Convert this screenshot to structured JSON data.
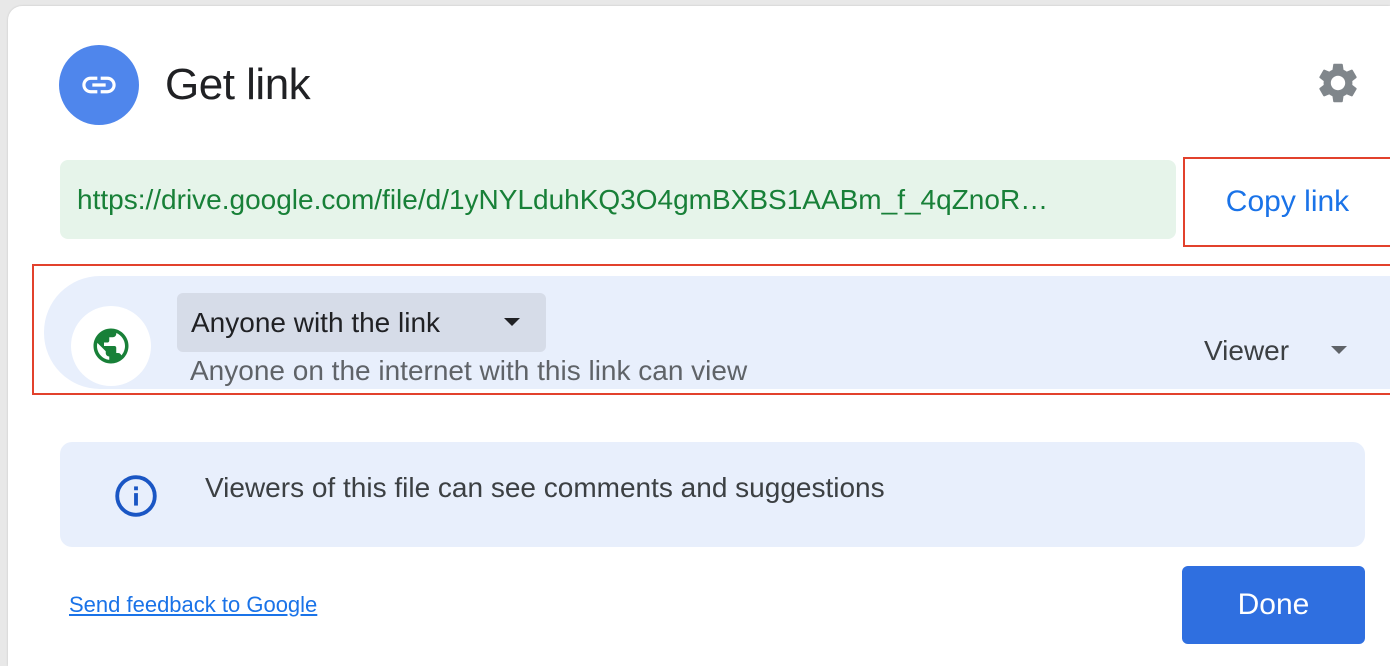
{
  "dialog": {
    "title": "Get link",
    "header_icon": "link-icon",
    "settings_icon": "gear-icon"
  },
  "link": {
    "url": "https://drive.google.com/file/d/1yNYLduhKQ3O4gmBXBS1AABm_f_4qZnoR…",
    "copy_label": "Copy link"
  },
  "access": {
    "icon": "globe-icon",
    "scope_label": "Anyone with the link",
    "scope_description": "Anyone on the internet with this link can view",
    "role_label": "Viewer"
  },
  "info": {
    "icon": "info-icon",
    "text": "Viewers of this file can see comments and suggestions"
  },
  "footer": {
    "feedback_label": "Send feedback to Google",
    "done_label": "Done"
  },
  "colors": {
    "accent": "#1a73e8",
    "link_bg": "#e6f4ea",
    "link_text": "#188038",
    "highlight_border": "#e2412c",
    "access_bg": "#e8effc"
  }
}
